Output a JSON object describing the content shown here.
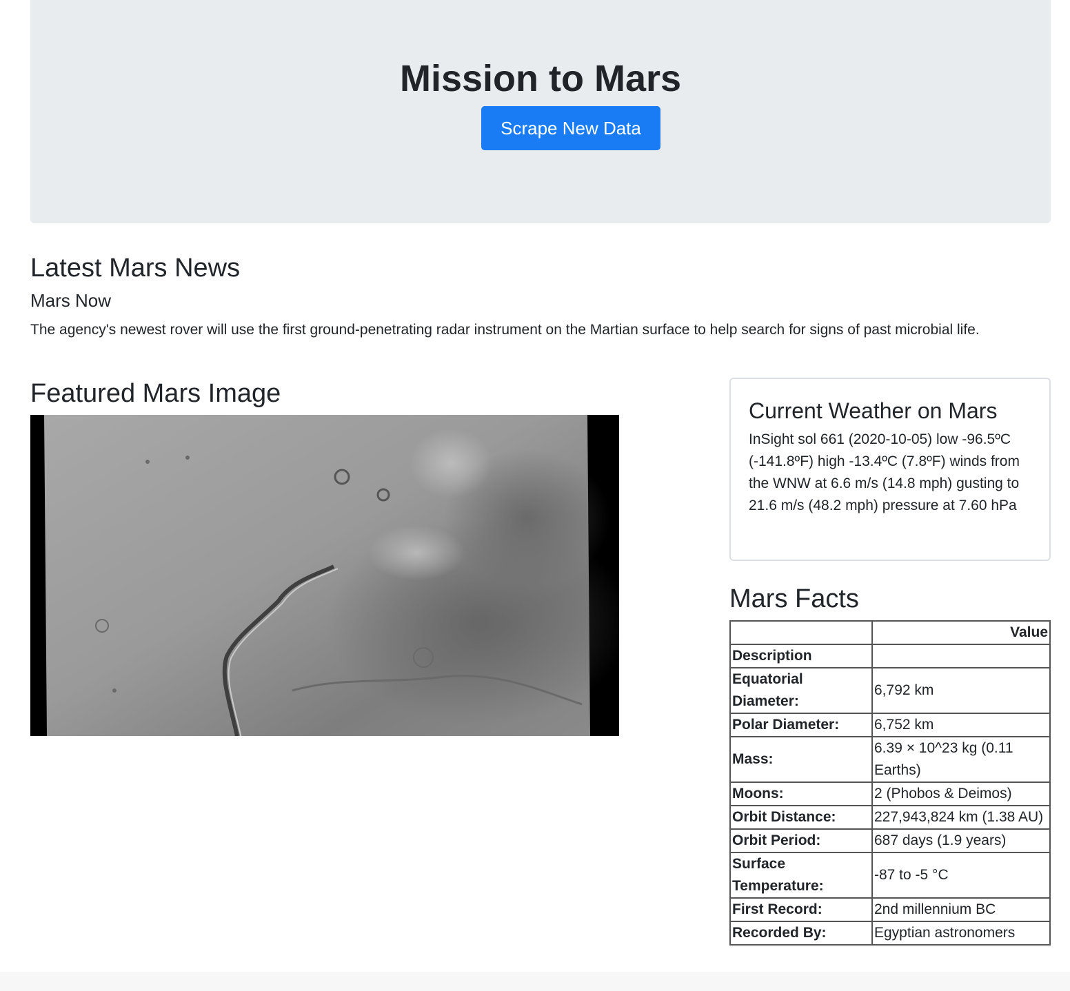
{
  "header": {
    "title": "Mission to Mars",
    "scrape_button": "Scrape New Data"
  },
  "news": {
    "section_title": "Latest Mars News",
    "headline": "Mars Now",
    "body": "The agency's newest rover will use the first ground-penetrating radar instrument on the Martian surface to help search for signs of past microbial life."
  },
  "featured": {
    "section_title": "Featured Mars Image"
  },
  "weather": {
    "title": "Current Weather on Mars",
    "text": "InSight sol 661 (2020-10-05) low -96.5ºC (-141.8ºF) high -13.4ºC (7.8ºF) winds from the WNW at 6.6 m/s (14.8 mph) gusting to 21.6 m/s (48.2 mph) pressure at 7.60 hPa"
  },
  "facts": {
    "section_title": "Mars Facts",
    "column_header": "Value",
    "index_header": "Description",
    "rows": [
      {
        "label": "Equatorial Diameter:",
        "value": "6,792 km"
      },
      {
        "label": "Polar Diameter:",
        "value": "6,752 km"
      },
      {
        "label": "Mass:",
        "value": "6.39 × 10^23 kg (0.11 Earths)"
      },
      {
        "label": "Moons:",
        "value": "2 (Phobos & Deimos)"
      },
      {
        "label": "Orbit Distance:",
        "value": "227,943,824 km (1.38 AU)"
      },
      {
        "label": "Orbit Period:",
        "value": "687 days (1.9 years)"
      },
      {
        "label": "Surface Temperature:",
        "value": "-87 to -5 °C"
      },
      {
        "label": "First Record:",
        "value": "2nd millennium BC"
      },
      {
        "label": "Recorded By:",
        "value": "Egyptian astronomers"
      }
    ]
  },
  "colors": {
    "jumbotron_bg": "#e9ecef",
    "primary_button": "#1a7cf5"
  }
}
